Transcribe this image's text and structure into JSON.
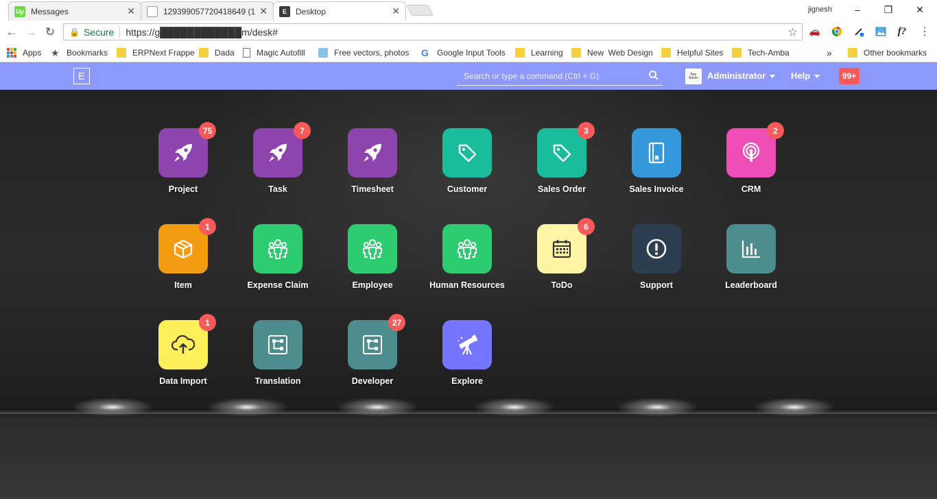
{
  "browser": {
    "tabs": [
      {
        "title": "Messages",
        "favicon": "Up",
        "favicon_color": "#6fda44",
        "active": false
      },
      {
        "title": "129399057720418649 (1",
        "favicon": "doc",
        "favicon_color": "#ffffff",
        "active": false
      },
      {
        "title": "Desktop",
        "favicon": "E",
        "favicon_color": "#3c3c3c",
        "active": true
      }
    ],
    "user": "jignesh",
    "address": {
      "secure_label": "Secure",
      "url": "https://g████████████m/desk#"
    },
    "bookmarks": [
      {
        "label": "Apps",
        "icon": "apps-grid-icon"
      },
      {
        "label": "Bookmarks",
        "icon": "star-icon"
      },
      {
        "label": "ERPNext Frappe",
        "icon": "folder-icon"
      },
      {
        "label": "Dada",
        "icon": "folder-icon"
      },
      {
        "label": "Magic Autofill",
        "icon": "page-icon"
      },
      {
        "label": "Free vectors, photos a",
        "icon": "cloud-icon"
      },
      {
        "label": "Google Input Tools",
        "icon": "google-icon"
      },
      {
        "label": "Learning",
        "icon": "folder-icon"
      },
      {
        "label": "New  Web Design",
        "icon": "folder-icon"
      },
      {
        "label": "Helpful Sites",
        "icon": "folder-icon"
      },
      {
        "label": "Tech-Amba",
        "icon": "folder-icon"
      }
    ],
    "overflow": "»",
    "other_bookmarks": "Other bookmarks"
  },
  "navbar": {
    "brand": "E",
    "search_placeholder": "Search or type a command (Ctrl + G)",
    "user": "Administrator",
    "avatar_text": "Bee Admin",
    "help": "Help",
    "notifications": "99+",
    "accent": "#8d99fb"
  },
  "modules": [
    {
      "label": "Project",
      "icon": "rocket-icon",
      "color": "#8e44ad",
      "badge": "75"
    },
    {
      "label": "Task",
      "icon": "rocket-icon",
      "color": "#8e44ad",
      "badge": "7"
    },
    {
      "label": "Timesheet",
      "icon": "rocket-icon",
      "color": "#8e44ad",
      "badge": ""
    },
    {
      "label": "Customer",
      "icon": "tag-icon",
      "color": "#1abc9c",
      "badge": ""
    },
    {
      "label": "Sales Order",
      "icon": "tag-icon",
      "color": "#1abc9c",
      "badge": "3"
    },
    {
      "label": "Sales Invoice",
      "icon": "book-icon",
      "color": "#3498db",
      "badge": ""
    },
    {
      "label": "CRM",
      "icon": "broadcast-icon",
      "color": "#ef4db6",
      "badge": "2"
    },
    {
      "label": "Item",
      "icon": "box-icon",
      "color": "#f39c12",
      "badge": "1"
    },
    {
      "label": "Expense Claim",
      "icon": "users-icon",
      "color": "#2ecc71",
      "badge": ""
    },
    {
      "label": "Employee",
      "icon": "users-icon",
      "color": "#2ecc71",
      "badge": ""
    },
    {
      "label": "Human Resources",
      "icon": "users-icon",
      "color": "#2ecc71",
      "badge": ""
    },
    {
      "label": "ToDo",
      "icon": "calendar-icon",
      "color": "#fff5a5",
      "badge": "6"
    },
    {
      "label": "Support",
      "icon": "alert-icon",
      "color": "#2c3e50",
      "badge": ""
    },
    {
      "label": "Leaderboard",
      "icon": "chart-icon",
      "color": "#4d8d8d",
      "badge": ""
    },
    {
      "label": "Data Import",
      "icon": "upload-icon",
      "color": "#ffef5b",
      "badge": "1"
    },
    {
      "label": "Translation",
      "icon": "flowchart-icon",
      "color": "#4d8d8d",
      "badge": ""
    },
    {
      "label": "Developer",
      "icon": "flowchart-icon",
      "color": "#4d8d8d",
      "badge": "27"
    },
    {
      "label": "Explore",
      "icon": "telescope-icon",
      "color": "#7575ff",
      "badge": ""
    }
  ]
}
